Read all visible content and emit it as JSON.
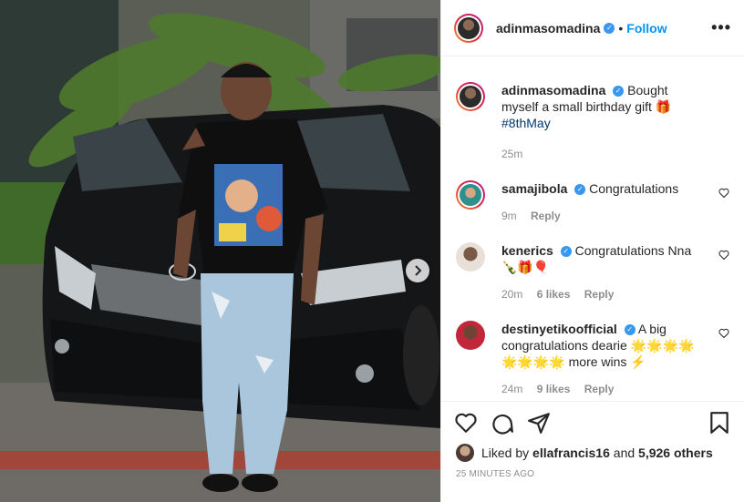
{
  "post": {
    "username": "adinmasomadina",
    "follow_label": "Follow",
    "separator": "•",
    "more_label": "•••",
    "caption_text": "Bought myself a small birthday gift 🎁",
    "caption_hashtag": "#8thMay",
    "caption_time": "25m"
  },
  "comments": [
    {
      "username": "samajibola",
      "text": "Congratulations",
      "time": "9m",
      "likes": "",
      "reply": "Reply"
    },
    {
      "username": "kenerics",
      "text": "Congratulations Nna 🍾🎁🎈",
      "time": "20m",
      "likes": "6 likes",
      "reply": "Reply"
    },
    {
      "username": "destinyetikoofficial",
      "text": "A big congratulations dearie 🌟🌟🌟🌟 🌟🌟🌟🌟 more wins ⚡",
      "time": "24m",
      "likes": "9 likes",
      "reply": "Reply"
    }
  ],
  "likes": {
    "prefix": "Liked by",
    "user": "ellafrancis16",
    "middle": "and",
    "count": "5,926 others"
  },
  "timestamp": "25 MINUTES AGO",
  "colors": {
    "accent": "#0095f6",
    "verified": "#3897f0",
    "hashtag": "#00376b"
  },
  "icons": [
    "heart-icon",
    "comment-icon",
    "share-icon",
    "bookmark-icon",
    "verified-icon",
    "chevron-right-icon"
  ]
}
